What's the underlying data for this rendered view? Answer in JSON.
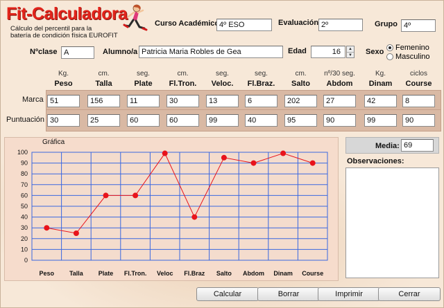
{
  "app": {
    "title": "Fit-Calculadora",
    "subtitle_line1": "Cálculo del percentil para la",
    "subtitle_line2": "batería de condición física EUROFIT"
  },
  "header": {
    "curso_label": "Curso Académico",
    "curso_value": "4º ESO",
    "evaluacion_label": "Evaluación",
    "evaluacion_value": "2º",
    "grupo_label": "Grupo",
    "grupo_value": "4º",
    "nclase_label": "Nºclase",
    "nclase_value": "A",
    "alumno_label": "Alumno/a",
    "alumno_value": "Patricia Maria Robles de Gea",
    "edad_label": "Edad",
    "edad_value": "16",
    "sexo_label": "Sexo",
    "sexo_options": [
      "Femenino",
      "Masculino"
    ],
    "sexo_selected": "Femenino"
  },
  "tests": {
    "units": [
      "Kg.",
      "cm.",
      "seg.",
      "cm.",
      "seg.",
      "seg.",
      "cm.",
      "nº/30 seg.",
      "Kg.",
      "ciclos"
    ],
    "names": [
      "Peso",
      "Talla",
      "Plate",
      "Fl.Tron.",
      "Veloc.",
      "Fl.Braz.",
      "Salto",
      "Abdom",
      "Dinam",
      "Course"
    ],
    "marca_label": "Marca",
    "marca": [
      "51",
      "156",
      "11",
      "30",
      "13",
      "6",
      "202",
      "27",
      "42",
      "8"
    ],
    "puntuacion_label": "Puntuación",
    "puntuacion": [
      "30",
      "25",
      "60",
      "60",
      "99",
      "40",
      "95",
      "90",
      "99",
      "90"
    ]
  },
  "chart_panel": {
    "title": "Gráfica"
  },
  "chart_data": {
    "type": "line",
    "categories": [
      "Peso",
      "Talla",
      "Plate",
      "Fl.Tron.",
      "Veloc",
      "Fl.Braz",
      "Salto",
      "Abdom",
      "Dinam",
      "Course"
    ],
    "values": [
      30,
      25,
      60,
      60,
      99,
      40,
      95,
      90,
      99,
      90
    ],
    "ylim": [
      0,
      100
    ],
    "yticks": [
      "0",
      "10",
      "20",
      "30",
      "40",
      "50",
      "60",
      "70",
      "80",
      "90",
      "100"
    ],
    "grid": true,
    "line_color": "#e8131b",
    "grid_color": "#3a67e0"
  },
  "side": {
    "media_label": "Media:",
    "media_value": "69",
    "observaciones_label": "Observaciones:",
    "observaciones_value": ""
  },
  "buttons": {
    "calcular": "Calcular",
    "borrar": "Borrar",
    "imprimir": "Imprimir",
    "cerrar": "Cerrar"
  }
}
